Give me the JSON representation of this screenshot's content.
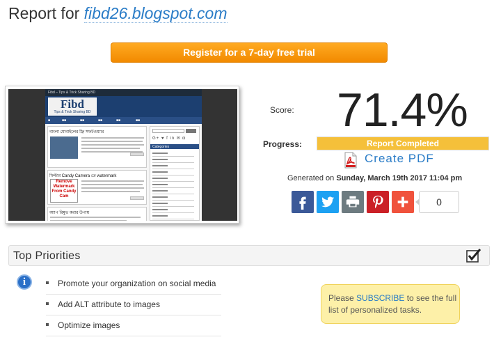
{
  "header": {
    "title_prefix": "Report for",
    "site": "fibd26.blogspot.com"
  },
  "cta": {
    "register_label": "Register for a 7-day free trial"
  },
  "thumbnail": {
    "topbar_text": "Fibd – Tips & Trick Sharing BD",
    "logo_text": "Fibd",
    "logo_sub": "Tips & Trick Sharing BD",
    "category_label": "Categories",
    "post_titles": [
      "বাংলা মোবাইলের ফ্রি সফটওয়্যার",
      "ফিল্টার Candy Camera তে watermark",
      "অ্যাপ রিমুভ করার উপায়"
    ],
    "post_image_caption": "Remove Watermark From Candy Cam",
    "social_glyphs": "G+ ♥ f in ✉ ◘"
  },
  "score": {
    "label": "Score:",
    "value": "71.4%",
    "value_number": 71.4
  },
  "progress": {
    "label": "Progress:",
    "status": "Report Completed",
    "fraction": 1.0
  },
  "pdf": {
    "label": "Create PDF"
  },
  "generated": {
    "prefix": "Generated on",
    "datetime": "Sunday, March 19th 2017 11:04 pm"
  },
  "share": {
    "buttons": [
      {
        "name": "facebook",
        "icon": "facebook-icon",
        "color": "#3b5998"
      },
      {
        "name": "twitter",
        "icon": "twitter-icon",
        "color": "#1da1f2"
      },
      {
        "name": "print",
        "icon": "print-icon",
        "color": "#6d7b80"
      },
      {
        "name": "pinterest",
        "icon": "pinterest-icon",
        "color": "#cb2027"
      },
      {
        "name": "more",
        "icon": "plus-icon",
        "color": "#f0523c"
      }
    ],
    "count": "0"
  },
  "priorities": {
    "title": "Top Priorities",
    "items": [
      "Promote your organization on social media",
      "Add ALT attribute to images",
      "Optimize images"
    ],
    "subscribe": {
      "before": "Please ",
      "link": "SUBSCRIBE",
      "after": " to see the full list of personalized tasks."
    }
  },
  "colors": {
    "accent_orange": "#f28a00",
    "link_blue": "#2a7cc7",
    "progress_yellow": "#f5c03a",
    "subscribe_bg": "#fdf0a8"
  }
}
